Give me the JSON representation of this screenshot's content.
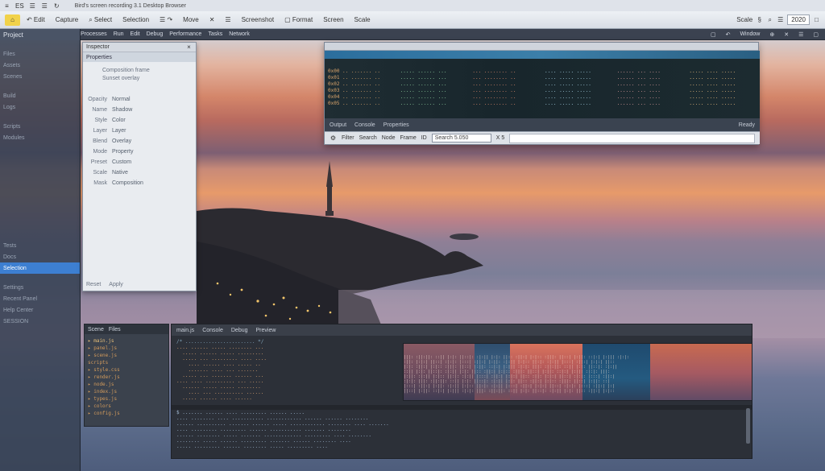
{
  "menubar": {
    "items": [
      "≡",
      "ES",
      "☰",
      "☰",
      "↻"
    ],
    "title": "Bird's screen recording 3.1 Desktop Browser"
  },
  "toolbar": {
    "buttons": [
      "↶ Edit",
      "Capture",
      "⌕ Select",
      "Selection",
      "☰ ↷",
      "Move",
      "✕",
      "☰",
      "Screenshot",
      "▢ Format",
      "Screen",
      "Scale"
    ],
    "right_labels": [
      "Scale",
      "§",
      "⌕",
      "☰"
    ],
    "zoom_value": "2020",
    "right_extra": "□"
  },
  "secondary_toolbar": {
    "items": [
      "Processes",
      "Run",
      "Edit",
      "Debug",
      "Performance",
      "Tasks",
      "Network"
    ],
    "tabs_right": [
      "▢",
      "↶",
      "Window",
      "⊕",
      "✕",
      "☰",
      "▢"
    ]
  },
  "sidebar": {
    "header": "Project",
    "items": [
      "Files",
      "Assets",
      "Scenes",
      "Build",
      "Logs",
      "Scripts",
      "Modules",
      "Tests",
      "Docs"
    ],
    "selected_label": "Selection",
    "footer": [
      "Settings",
      "Recent Panel",
      "Help Center",
      "SESSION"
    ]
  },
  "props_panel": {
    "title": "Inspector",
    "sub": "Properties",
    "group_lines": [
      "Composition frame",
      "Sunset overlay"
    ],
    "rows": [
      [
        "Opacity",
        "Normal"
      ],
      [
        "Name",
        "Shadow"
      ],
      [
        "Style",
        "Color"
      ],
      [
        "Layer",
        "Layer"
      ],
      [
        "Blend",
        "Overlay"
      ],
      [
        "Mode",
        "Property"
      ],
      [
        "Preset",
        "Custom"
      ],
      [
        "Scale",
        "Native"
      ],
      [
        "Mask",
        "Composition"
      ]
    ],
    "bottom": [
      "Reset",
      "Apply"
    ]
  },
  "log_window": {
    "status_left": [
      "Output",
      "Console",
      "Properties"
    ],
    "status_right": "Ready",
    "input_items": [
      "Filter",
      "Search",
      "Node",
      "Frame",
      "ID"
    ],
    "field_value": "Search 5.050",
    "counter": "X 5"
  },
  "tree_panel": {
    "tabs": [
      "Scene",
      "Files"
    ],
    "items": [
      "▸ main.js",
      "  ▸ panel.js",
      "  ▸ scene.js",
      "    scripts",
      "  ▸ style.css",
      "  ▸ render.js",
      "  ▸ node.js",
      "  ▸ index.js",
      "  ▸ types.js",
      "  ▸ colors",
      "  ▸ config.js"
    ]
  },
  "code_panel": {
    "tabs": [
      "main.js",
      "Console",
      "Debug",
      "Preview"
    ]
  },
  "colors": {
    "selection": "#3d7fd1",
    "accent": "#f1d24a",
    "code_orange": "#d6a070",
    "log_header": "#3c7fa9"
  }
}
